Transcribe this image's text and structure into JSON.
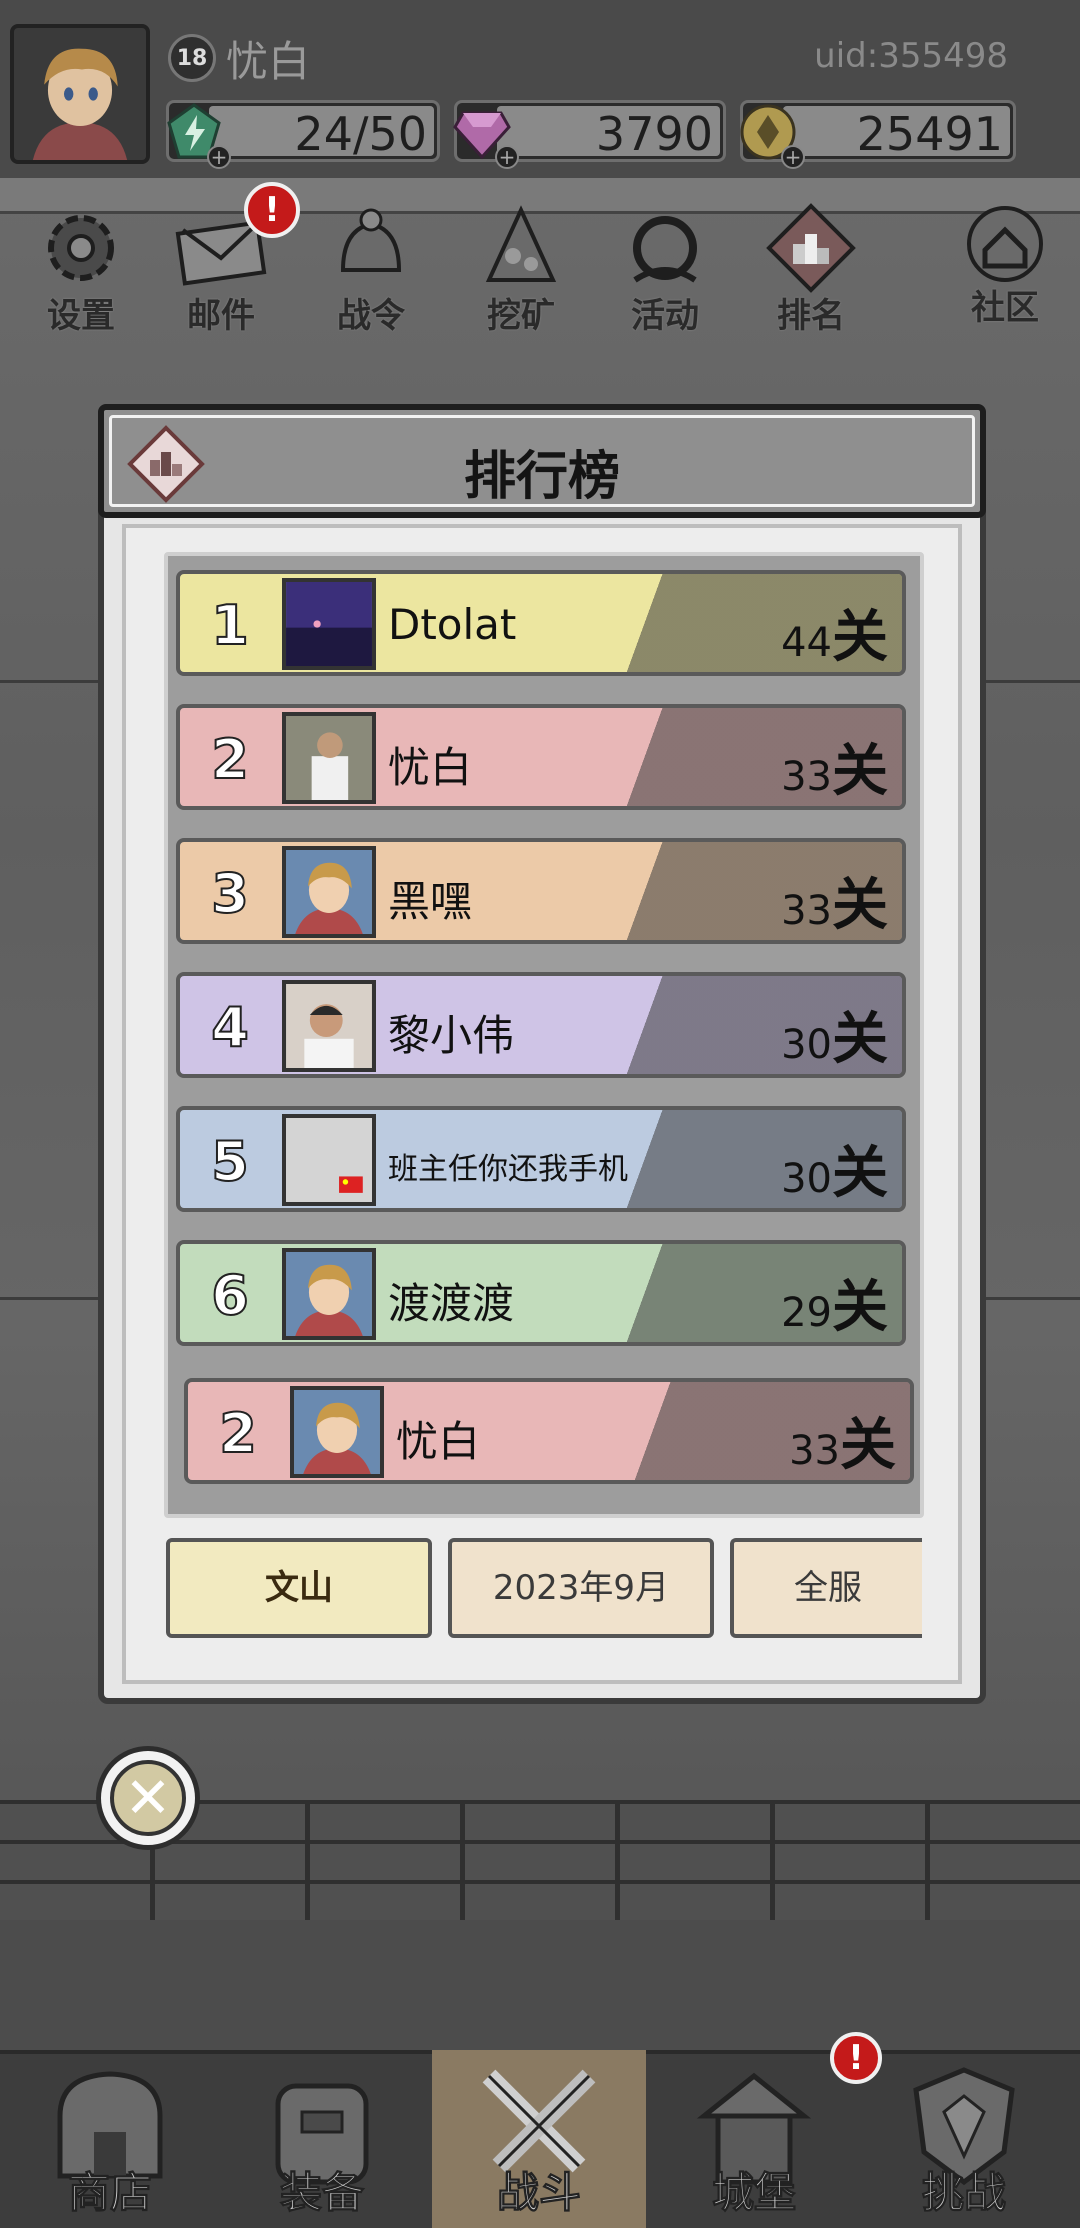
{
  "header": {
    "level": "18",
    "player_name": "忧白",
    "uid": "uid:355498",
    "resources": [
      {
        "name": "energy",
        "icon": "lightning-gem-icon",
        "value": "24/50"
      },
      {
        "name": "diamonds",
        "icon": "purple-diamond-icon",
        "value": "3790"
      },
      {
        "name": "gold",
        "icon": "gold-coin-icon",
        "value": "25491"
      }
    ]
  },
  "top_menu": [
    {
      "label": "设置",
      "icon": "gear-icon"
    },
    {
      "label": "邮件",
      "icon": "mail-icon",
      "badge": "!"
    },
    {
      "label": "战令",
      "icon": "battle-pass-icon"
    },
    {
      "label": "挖矿",
      "icon": "mining-icon"
    },
    {
      "label": "活动",
      "icon": "event-icon"
    },
    {
      "label": "排名",
      "icon": "ranking-icon"
    },
    {
      "label": "社区",
      "icon": "home-community-icon"
    }
  ],
  "leaderboard": {
    "title": "排行榜",
    "stage_unit": "关",
    "rows": [
      {
        "rank": "1",
        "name": "Dtolat",
        "score": "44",
        "color": "#ece6a0"
      },
      {
        "rank": "2",
        "name": "忧白",
        "score": "33",
        "color": "#e8b7b7"
      },
      {
        "rank": "3",
        "name": "黑嘿",
        "score": "33",
        "color": "#eccaa8"
      },
      {
        "rank": "4",
        "name": "黎小伟",
        "score": "30",
        "color": "#cfc4e6"
      },
      {
        "rank": "5",
        "name": "班主任你还我手机",
        "score": "30",
        "color": "#bccbe0"
      },
      {
        "rank": "6",
        "name": "渡渡渡",
        "score": "29",
        "color": "#c2dcbc"
      }
    ],
    "self_row": {
      "rank": "2",
      "name": "忧白",
      "score": "33",
      "color": "#e8b7b7"
    },
    "tabs": [
      {
        "label": "文山",
        "selected": true
      },
      {
        "label": "2023年9月",
        "selected": false
      },
      {
        "label": "全服",
        "selected": false
      }
    ]
  },
  "bottom_nav": [
    {
      "label": "商店",
      "icon": "shop-icon"
    },
    {
      "label": "装备",
      "icon": "backpack-icon"
    },
    {
      "label": "战斗",
      "icon": "crossed-swords-icon",
      "active": true
    },
    {
      "label": "城堡",
      "icon": "castle-icon",
      "badge": "!"
    },
    {
      "label": "挑战",
      "icon": "shield-crest-icon"
    }
  ]
}
